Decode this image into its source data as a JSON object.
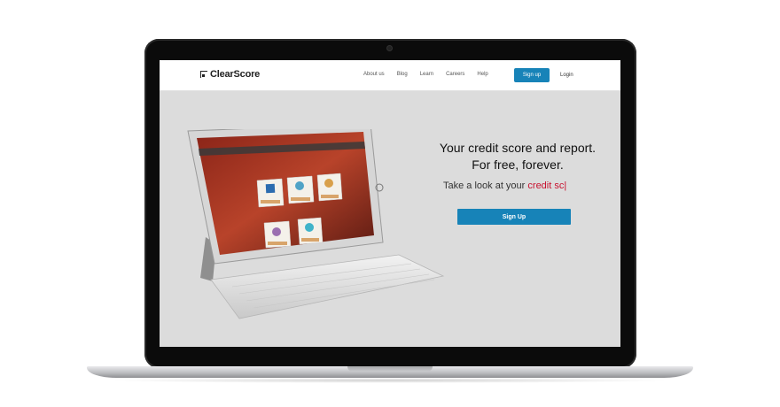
{
  "site": {
    "logo_text": "ClearScore",
    "nav": {
      "links": [
        "About us",
        "Blog",
        "Learn",
        "Careers",
        "Help"
      ],
      "signup_label": "Sign up",
      "login_label": "Login"
    },
    "hero": {
      "headline_line1": "Your credit score and report.",
      "headline_line2": "For free, forever.",
      "subline_prefix": "Take a look at your",
      "subline_typed": "credit sc",
      "cta_label": "Sign Up"
    }
  },
  "colors": {
    "brand_blue": "#1783b8",
    "accent_red": "#c8102e",
    "screen_bg": "#dcdcdc"
  }
}
